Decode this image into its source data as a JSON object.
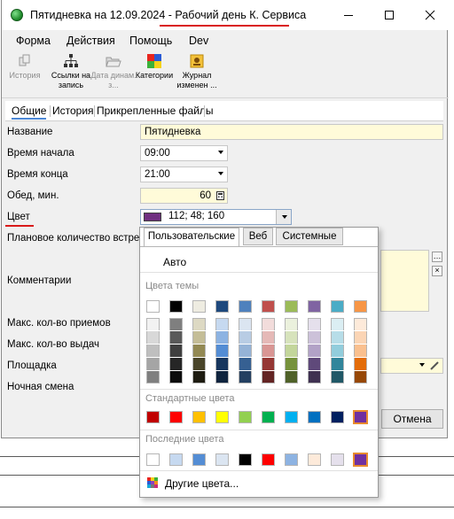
{
  "window": {
    "title": "Пятидневка на 12.09.2024 - Рабочий день К. Сервиса"
  },
  "menu": [
    "Форма",
    "Действия",
    "Помощь",
    "Dev"
  ],
  "toolbar": [
    {
      "label": "История",
      "icon": "history-icon",
      "enabled": false
    },
    {
      "label": "Ссылки на запись",
      "icon": "links-icon",
      "enabled": true
    },
    {
      "label": "Дата динам. з...",
      "icon": "folder-open-icon",
      "enabled": false
    },
    {
      "label": "Категории",
      "icon": "categories-icon",
      "enabled": true
    },
    {
      "label": "Журнал изменен ...",
      "icon": "journal-icon",
      "enabled": true
    }
  ],
  "tabs": [
    "Общие",
    "История",
    "Прикрепленные файлы"
  ],
  "fields": {
    "name_label": "Название",
    "name_value": "Пятидневка",
    "start_label": "Время начала",
    "start_value": "09:00",
    "end_label": "Время конца",
    "end_value": "21:00",
    "lunch_label": "Обед, мин.",
    "lunch_value": "60",
    "color_label": "Цвет",
    "color_value": "112; 48; 160",
    "planned_label": "Плановое количество встреч",
    "comments_label": "Комментарии",
    "max_receptions_label": "Макс. кол-во приемов",
    "max_issues_label": "Макс. кол-во выдач",
    "site_label": "Площадка",
    "night_shift_label": "Ночная смена"
  },
  "popup": {
    "tabs": [
      "Пользовательские",
      "Веб",
      "Системные"
    ],
    "auto_label": "Авто",
    "theme_title": "Цвета темы",
    "standard_title": "Стандартные цвета",
    "recent_title": "Последние цвета",
    "more_label": "Другие цвета..."
  },
  "palette": {
    "theme_top": [
      "#ffffff",
      "#000000",
      "#eeece1",
      "#1f497d",
      "#4f81bd",
      "#c0504d",
      "#9bbb59",
      "#8064a2",
      "#4bacc6",
      "#f79646"
    ],
    "theme_shades": [
      [
        "#f2f2f2",
        "#d8d8d8",
        "#bfbfbf",
        "#a5a5a5",
        "#7f7f7f"
      ],
      [
        "#7f7f7f",
        "#595959",
        "#3f3f3f",
        "#262626",
        "#0c0c0c"
      ],
      [
        "#ddd9c3",
        "#c4bd97",
        "#938953",
        "#494429",
        "#1d1b10"
      ],
      [
        "#c6d9f0",
        "#8db3e2",
        "#548dd4",
        "#17365d",
        "#0f243e"
      ],
      [
        "#dbe5f1",
        "#b8cce4",
        "#95b3d7",
        "#366092",
        "#244061"
      ],
      [
        "#f2dcdb",
        "#e5b9b7",
        "#d99694",
        "#953734",
        "#632423"
      ],
      [
        "#ebf1dd",
        "#d7e3bc",
        "#c3d69b",
        "#76923c",
        "#4f6128"
      ],
      [
        "#e5e0ec",
        "#ccc1d9",
        "#b2a2c7",
        "#5f497a",
        "#3f3151"
      ],
      [
        "#dbeef3",
        "#b7dde8",
        "#92cddc",
        "#31859b",
        "#205867"
      ],
      [
        "#fdeada",
        "#fbd5b5",
        "#fac08f",
        "#e36c09",
        "#974806"
      ]
    ],
    "standard": [
      "#c00000",
      "#ff0000",
      "#ffc000",
      "#ffff00",
      "#92d050",
      "#00b050",
      "#00b0f0",
      "#0070c0",
      "#002060",
      "#7030a0"
    ],
    "recent": [
      "#ffffff",
      "#c6d9f0",
      "#548dd4",
      "#dbe5f1",
      "#000000",
      "#ff0000",
      "#8db3e2",
      "#fdeada",
      "#e5e0ec",
      "#7030a0"
    ]
  },
  "buttons": {
    "cancel": "Отмена"
  }
}
